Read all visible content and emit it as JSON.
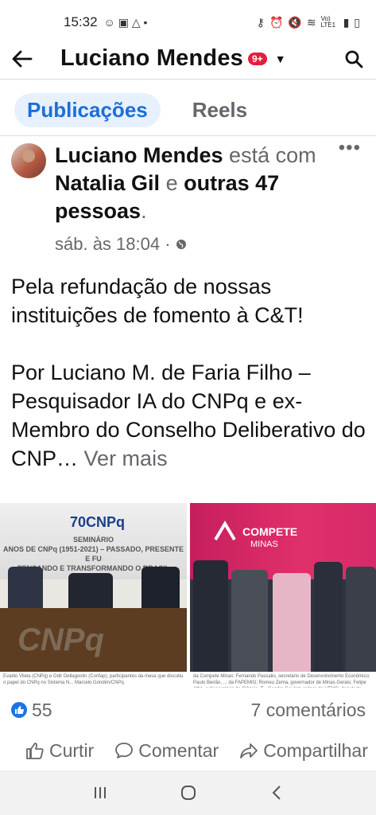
{
  "status_bar": {
    "time": "15:32",
    "network": "Vo) LTE1"
  },
  "header": {
    "title": "Luciano Mendes",
    "badge": "9+"
  },
  "tabs": [
    {
      "label": "Publicações",
      "active": true
    },
    {
      "label": "Reels",
      "active": false
    }
  ],
  "post": {
    "author": "Luciano Mendes",
    "is_with": "está com",
    "tagged": "Natalia Gil",
    "conj": "e",
    "others": "outras 47 pessoas",
    "time": "sáb. às 18:04 ·",
    "paragraph1": "Pela refundação de nossas instituições de fomento à C&T!",
    "paragraph2": "Por Luciano M. de Faria Filho – Pesquisador IA do CNPq e ex-Membro do Conselho Deliberativo do CNP…",
    "see_more": "Ver mais"
  },
  "photos": {
    "left": {
      "logo": "70CNPq",
      "seminar_title": "SEMINÁRIO",
      "seminar_subtitle": "ANOS DE CNPq (1951-2021) – PASSADO, PRESENTE E FU",
      "seminar_line2": "PENSANDO E TRANSFORMANDO O BRASIL",
      "table_logo": "CNPq",
      "caption": "Evaldo Vilela (CNPq) e Odir Dellagostin (Confap), participantes da mesa que discutiu o papel do CNPq no Sistema N... Marcelo Gondim/CNPq"
    },
    "right": {
      "banner_line1": "COMPETE",
      "banner_line2": "MINAS",
      "caption": "da Compete Minas: Fernando Passalio, secretário de Desenvolvimento Econômico; Paulo Beirão, ... da FAPEMIG; Romeu Zema, governador de Minas Gerais; Felipe Attié, subsecretário de Ciência, T... Sandra Goulart, reitora da UFMG; deputado estadual Antônio Carlos Arantes; Flávio Roscoe, pre... Veras, presidente do Conselho de Tecnologia e Inovação da Federação das Indústrias. Fotos: Mi.../Imprensa MG"
    }
  },
  "reactions": {
    "likes": "55",
    "comments": "7 comentários"
  },
  "actions": {
    "like": "Curtir",
    "comment": "Comentar",
    "share": "Compartilhar"
  },
  "colors": {
    "accent": "#1b6fd8",
    "tab_active_bg": "#e7f0fd",
    "secondary_text": "#65676b",
    "like_blue": "#1b74e4",
    "compete_pink": "#d22c5c"
  }
}
